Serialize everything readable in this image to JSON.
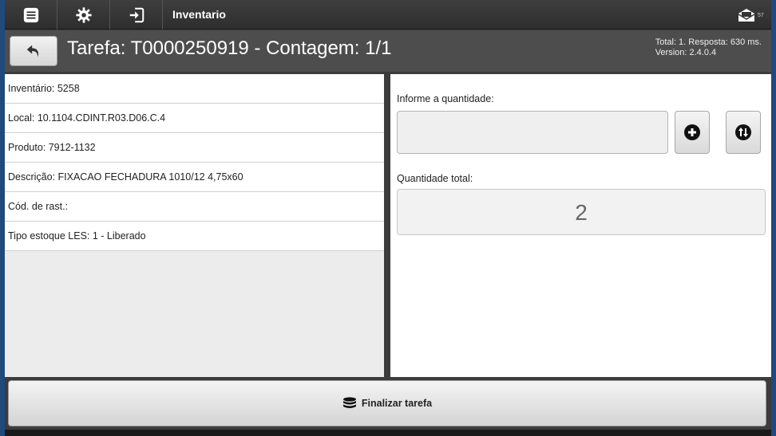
{
  "topbar": {
    "title": "Inventario",
    "icons": [
      "menu-icon",
      "gear-icon",
      "login-icon"
    ],
    "message_count": "57"
  },
  "header": {
    "title": "Tarefa: T0000250919 - Contagem: 1/1",
    "status_line1": "Total: 1. Resposta: 630 ms.",
    "status_line2": "Version: 2.4.0.4"
  },
  "details": [
    "Inventário: 5258",
    "Local: 10.1104.CDINT.R03.D06.C.4",
    "Produto: 7912-1132",
    "Descrição: FIXACAO FECHADURA 1010/12 4,75x60",
    "Cód. de rast.:",
    "Tipo estoque LES: 1 - Liberado"
  ],
  "quantity": {
    "label": "Informe a quantidade:",
    "value": "",
    "total_label": "Quantidade total:",
    "total_value": "2"
  },
  "footer": {
    "finish_label": "Finalizar tarefa"
  },
  "colors": {
    "topbar": "#353535",
    "titlebar": "#4d4d4d",
    "panel_bg": "#ececec",
    "button_bg": "#e6e6e6"
  }
}
